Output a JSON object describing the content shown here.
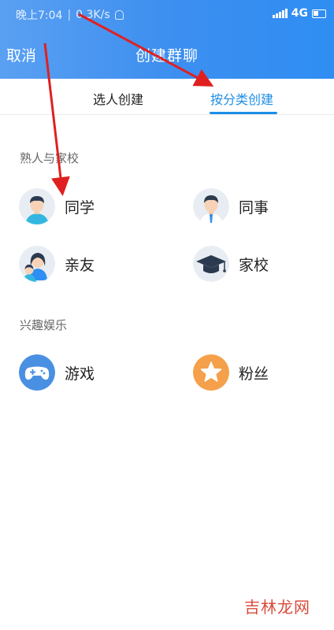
{
  "status_bar": {
    "time": "晚上7:04",
    "separator": "|",
    "speed": "0.3K/s",
    "network": "4G"
  },
  "navbar": {
    "cancel_label": "取消",
    "title": "创建群聊"
  },
  "tabs": [
    {
      "label": "选人创建",
      "active": false
    },
    {
      "label": "按分类创建",
      "active": true
    }
  ],
  "sections": [
    {
      "title": "熟人与家校",
      "items": [
        {
          "label": "同学",
          "icon": "student-icon"
        },
        {
          "label": "同事",
          "icon": "colleague-icon"
        },
        {
          "label": "亲友",
          "icon": "family-icon"
        },
        {
          "label": "家校",
          "icon": "graduation-cap-icon"
        }
      ]
    },
    {
      "title": "兴趣娱乐",
      "items": [
        {
          "label": "游戏",
          "icon": "gamepad-icon"
        },
        {
          "label": "粉丝",
          "icon": "star-icon"
        }
      ]
    }
  ],
  "watermark": "吉林龙网",
  "colors": {
    "header_blue": "#3d8ff0",
    "accent": "#1c8ee6",
    "game_blue": "#4a90e2",
    "fan_orange": "#f5a04a",
    "annotation_red": "#e02020"
  }
}
